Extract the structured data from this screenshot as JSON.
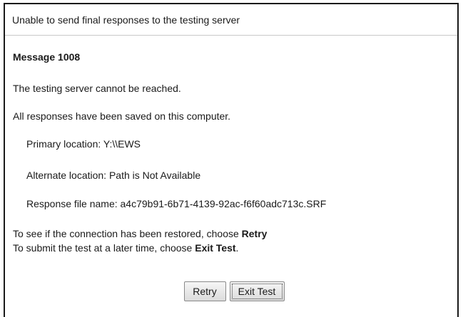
{
  "dialog": {
    "title": "Unable to send final responses to the testing server",
    "message_title": "Message 1008",
    "line1": "The testing server cannot be reached.",
    "line2": "All responses have been saved on this computer.",
    "primary_location": "Primary location: Y:\\\\EWS",
    "alternate_location": "Alternate location: Path is Not Available",
    "response_file": "Response file name: a4c79b91-6b71-4139-92ac-f6f60adc713c.SRF",
    "instr1_prefix": "To see if the connection has been restored, choose ",
    "instr1_action": "Retry",
    "instr2_prefix": "To submit the test at a later time, choose ",
    "instr2_action": "Exit Test",
    "instr2_suffix": "."
  },
  "buttons": {
    "retry_label": "Retry",
    "exit_label": "Exit Test"
  }
}
